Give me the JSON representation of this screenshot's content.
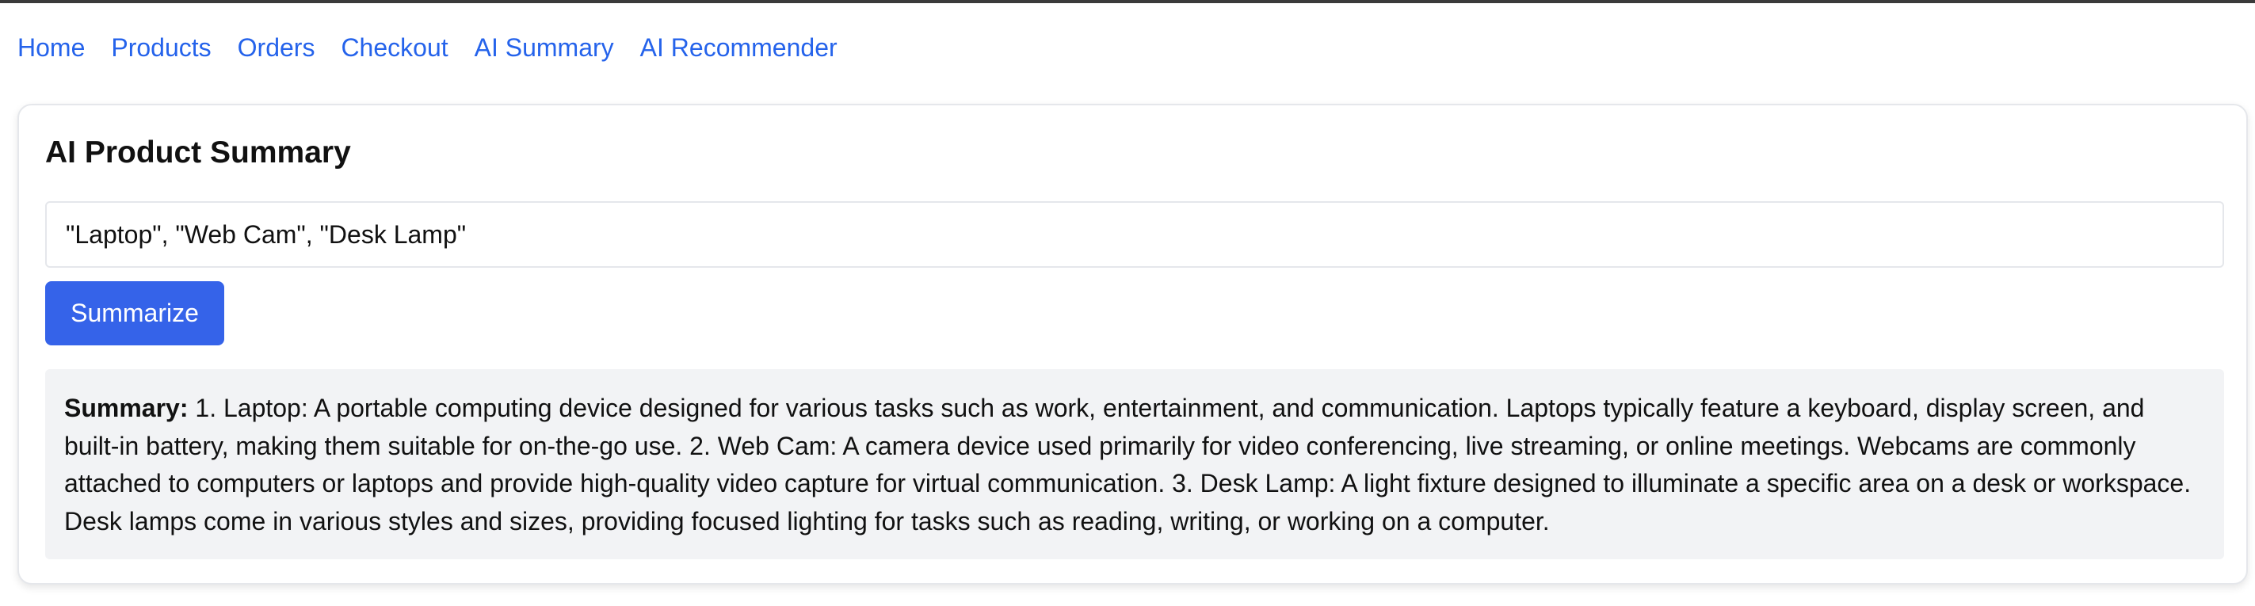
{
  "nav": {
    "items": [
      {
        "label": "Home"
      },
      {
        "label": "Products"
      },
      {
        "label": "Orders"
      },
      {
        "label": "Checkout"
      },
      {
        "label": "AI Summary"
      },
      {
        "label": "AI Recommender"
      }
    ]
  },
  "card": {
    "title": "AI Product Summary",
    "input_value": "\"Laptop\", \"Web Cam\", \"Desk Lamp\"",
    "button_label": "Summarize",
    "summary_label": "Summary:",
    "summary_text": " 1. Laptop: A portable computing device designed for various tasks such as work, entertainment, and communication. Laptops typically feature a keyboard, display screen, and built-in battery, making them suitable for on-the-go use. 2. Web Cam: A camera device used primarily for video conferencing, live streaming, or online meetings. Webcams are commonly attached to computers or laptops and provide high-quality video capture for virtual communication. 3. Desk Lamp: A light fixture designed to illuminate a specific area on a desk or workspace. Desk lamps come in various styles and sizes, providing focused lighting for tasks such as reading, writing, or working on a computer."
  },
  "colors": {
    "link": "#2563eb",
    "button": "#3563e9",
    "summary_bg": "#f2f3f5"
  }
}
